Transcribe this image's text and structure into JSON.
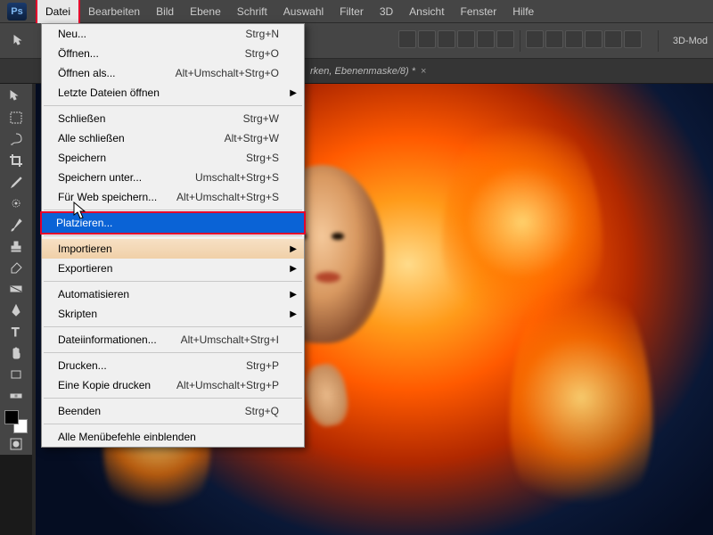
{
  "app_icon_text": "Ps",
  "menubar": [
    "Datei",
    "Bearbeiten",
    "Bild",
    "Ebene",
    "Schrift",
    "Auswahl",
    "Filter",
    "3D",
    "Ansicht",
    "Fenster",
    "Hilfe"
  ],
  "menubar_open_index": 0,
  "mode_3d_label": "3D-Mod",
  "tab": {
    "title": "rken, Ebenenmaske/8) *",
    "close": "×"
  },
  "dropdown": [
    {
      "type": "item",
      "label": "Neu...",
      "shortcut": "Strg+N"
    },
    {
      "type": "item",
      "label": "Öffnen...",
      "shortcut": "Strg+O"
    },
    {
      "type": "item",
      "label": "Öffnen als...",
      "shortcut": "Alt+Umschalt+Strg+O"
    },
    {
      "type": "item",
      "label": "Letzte Dateien öffnen",
      "submenu": true
    },
    {
      "type": "sep"
    },
    {
      "type": "item",
      "label": "Schließen",
      "shortcut": "Strg+W"
    },
    {
      "type": "item",
      "label": "Alle schließen",
      "shortcut": "Alt+Strg+W"
    },
    {
      "type": "item",
      "label": "Speichern",
      "shortcut": "Strg+S"
    },
    {
      "type": "item",
      "label": "Speichern unter...",
      "shortcut": "Umschalt+Strg+S"
    },
    {
      "type": "item",
      "label": "Für Web speichern...",
      "shortcut": "Alt+Umschalt+Strg+S"
    },
    {
      "type": "sep"
    },
    {
      "type": "item",
      "label": "Platzieren...",
      "highlight": "blue"
    },
    {
      "type": "sep"
    },
    {
      "type": "item",
      "label": "Importieren",
      "submenu": true,
      "highlight": "tan"
    },
    {
      "type": "item",
      "label": "Exportieren",
      "submenu": true
    },
    {
      "type": "sep"
    },
    {
      "type": "item",
      "label": "Automatisieren",
      "submenu": true
    },
    {
      "type": "item",
      "label": "Skripten",
      "submenu": true
    },
    {
      "type": "sep"
    },
    {
      "type": "item",
      "label": "Dateiinformationen...",
      "shortcut": "Alt+Umschalt+Strg+I"
    },
    {
      "type": "sep"
    },
    {
      "type": "item",
      "label": "Drucken...",
      "shortcut": "Strg+P"
    },
    {
      "type": "item",
      "label": "Eine Kopie drucken",
      "shortcut": "Alt+Umschalt+Strg+P"
    },
    {
      "type": "sep"
    },
    {
      "type": "item",
      "label": "Beenden",
      "shortcut": "Strg+Q"
    },
    {
      "type": "sep"
    },
    {
      "type": "item",
      "label": "Alle Menübefehle einblenden"
    }
  ],
  "tools": [
    "move",
    "marquee",
    "lasso",
    "crop",
    "eyedropper",
    "heal",
    "brush",
    "stamp",
    "eraser",
    "gradient",
    "pen",
    "text",
    "hand",
    "rect",
    "zoom"
  ],
  "swatch": {
    "fg": "#000000",
    "bg": "#ffffff"
  }
}
